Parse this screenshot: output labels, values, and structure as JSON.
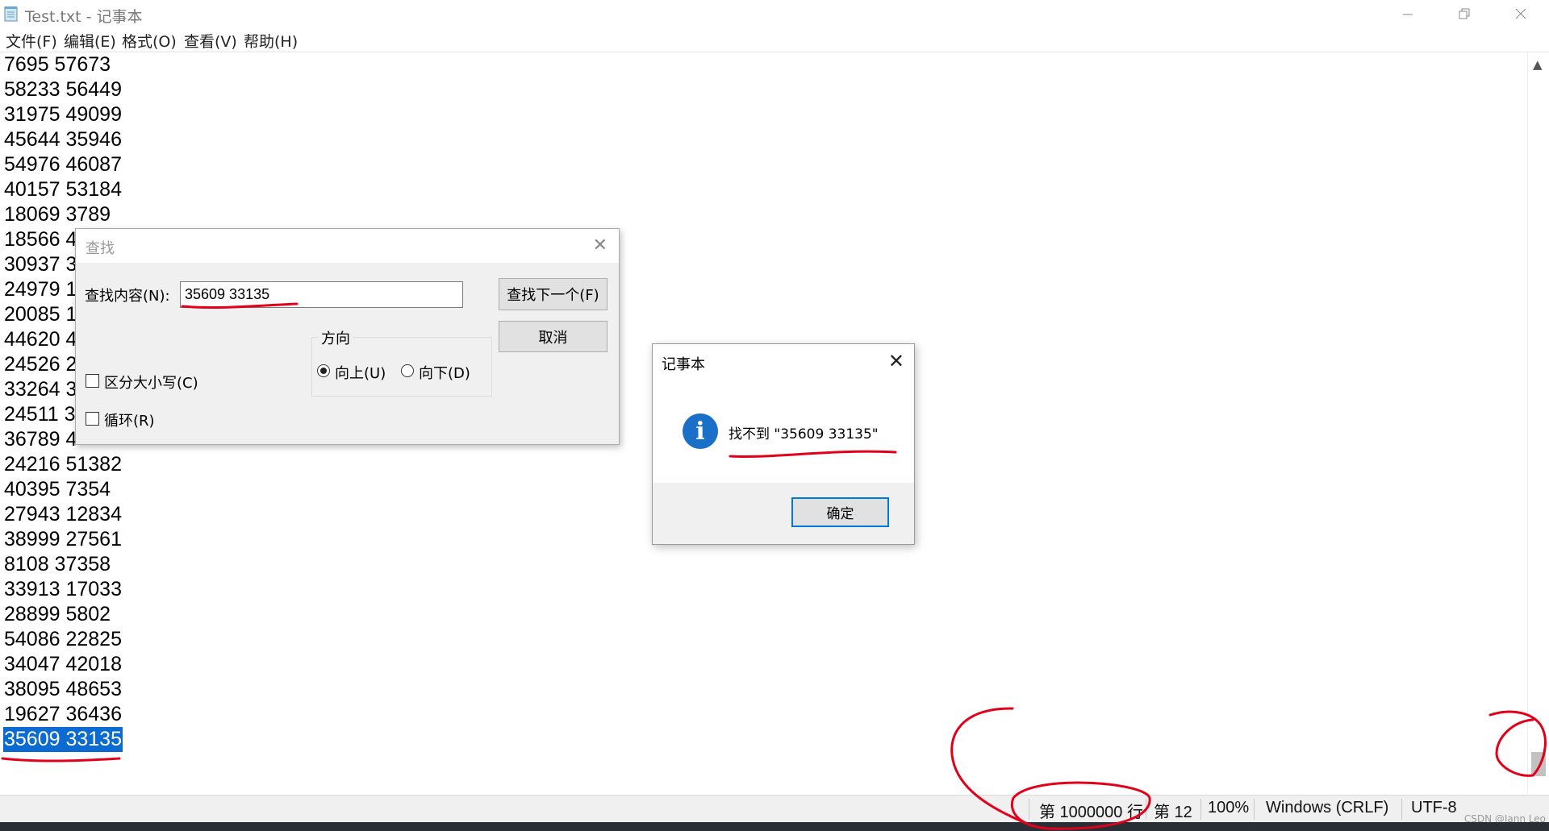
{
  "window": {
    "title": "Test.txt - 记事本",
    "icon": "notepad-icon",
    "controls": [
      "minimize-icon",
      "restore-icon",
      "close-icon"
    ]
  },
  "menu": {
    "items": [
      "文件(F)",
      "编辑(E)",
      "格式(O)",
      "查看(V)",
      "帮助(H)"
    ]
  },
  "editor": {
    "lines": [
      "7695 57673",
      "58233 56449",
      "31975 49099",
      "45644 35946",
      "54976 46087",
      "40157 53184",
      "18069 3789",
      "18566 4",
      "30937 3",
      "24979 1",
      "20085 1",
      "44620 4",
      "24526 2",
      "33264 3",
      "24511 3",
      "36789 4",
      "24216 51382",
      "40395 7354",
      "27943 12834",
      "38999 27561",
      "8108 37358",
      "33913 17033",
      "28899 5802",
      "54086 22825",
      "34047 42018",
      "38095 48653",
      "19627 36436",
      "35609 33135"
    ],
    "selected_line": "35609 33135"
  },
  "status": {
    "line": "第 1000000 行",
    "column": "第 12",
    "zoom": "100%",
    "eol": "Windows (CRLF)",
    "encoding": "UTF-8",
    "watermark": "CSDN @Jann Leo"
  },
  "find_dialog": {
    "title": "查找",
    "label": "查找内容(N):",
    "value": "35609 33135",
    "find_next": "查找下一个(F)",
    "cancel": "取消",
    "direction_label": "方向",
    "up": "向上(U)",
    "down": "向下(D)",
    "direction_selected": "up",
    "match_case": "区分大小写(C)",
    "wrap": "循环(R)",
    "match_case_checked": false,
    "wrap_checked": false
  },
  "message_box": {
    "title": "记事本",
    "text": "找不到 \"35609 33135\"",
    "ok": "确定",
    "icon": "info-icon"
  },
  "colors": {
    "selection": "#0b6bd0",
    "annotation": "#e3001b",
    "info_icon": "#1a6fc9",
    "ok_border": "#0078d7"
  }
}
